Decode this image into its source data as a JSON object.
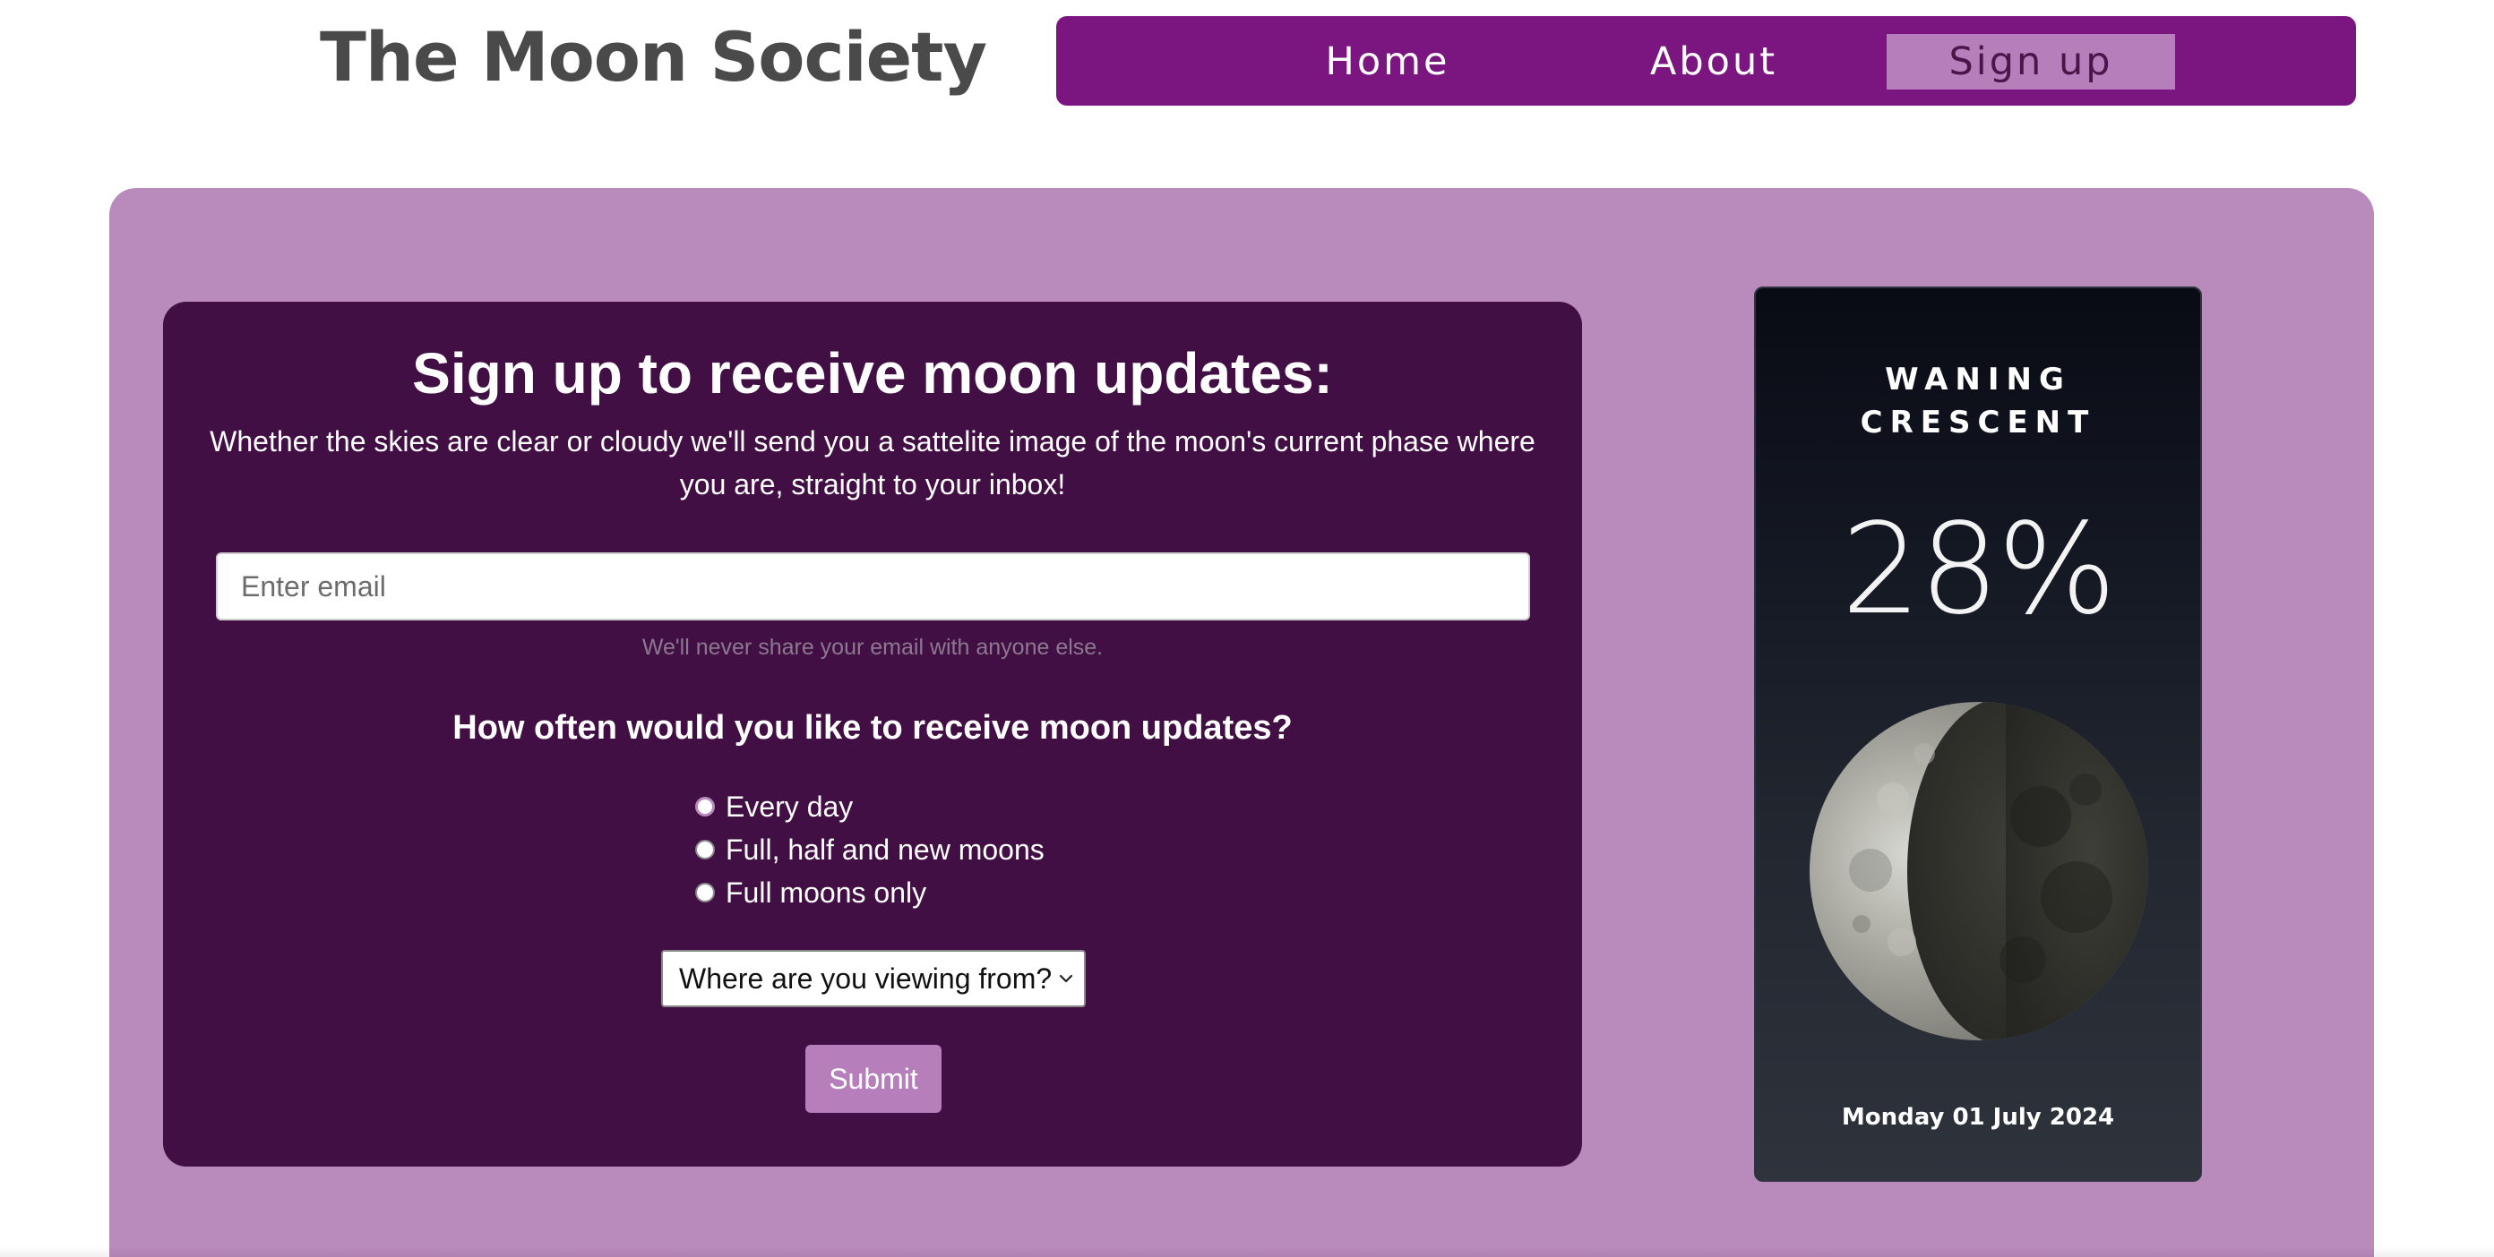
{
  "header": {
    "site_title": "The Moon Society"
  },
  "nav": {
    "items": [
      {
        "label": "Home",
        "active": false
      },
      {
        "label": "About",
        "active": false
      },
      {
        "label": "Sign up",
        "active": true
      }
    ]
  },
  "signup_form": {
    "heading": "Sign up to receive moon updates:",
    "description": "Whether the skies are clear or cloudy we'll send you a sattelite image of the moon's current phase where you are, straight to your inbox!",
    "email": {
      "placeholder": "Enter email",
      "value": "",
      "help_text": "We'll never share your email with anyone else."
    },
    "frequency": {
      "question": "How often would you like to receive moon updates?",
      "options": [
        {
          "label": "Every day",
          "checked": true
        },
        {
          "label": "Full, half and new moons",
          "checked": false
        },
        {
          "label": "Full moons only",
          "checked": false
        }
      ]
    },
    "location_select": {
      "selected": "Where are you viewing from?"
    },
    "submit_label": "Submit"
  },
  "moon_widget": {
    "phase_line1": "WANING",
    "phase_line2": "CRESCENT",
    "illumination": "28%",
    "date": "Monday 01 July 2024",
    "icon": "waning-crescent-moon"
  },
  "colors": {
    "nav_bg": "#7b1580",
    "nav_active_bg": "#b67fbc",
    "panel_bg": "#b98abc",
    "card_bg": "#420f45",
    "button_bg": "#b67fbc",
    "title_text": "#4a4a4a"
  }
}
